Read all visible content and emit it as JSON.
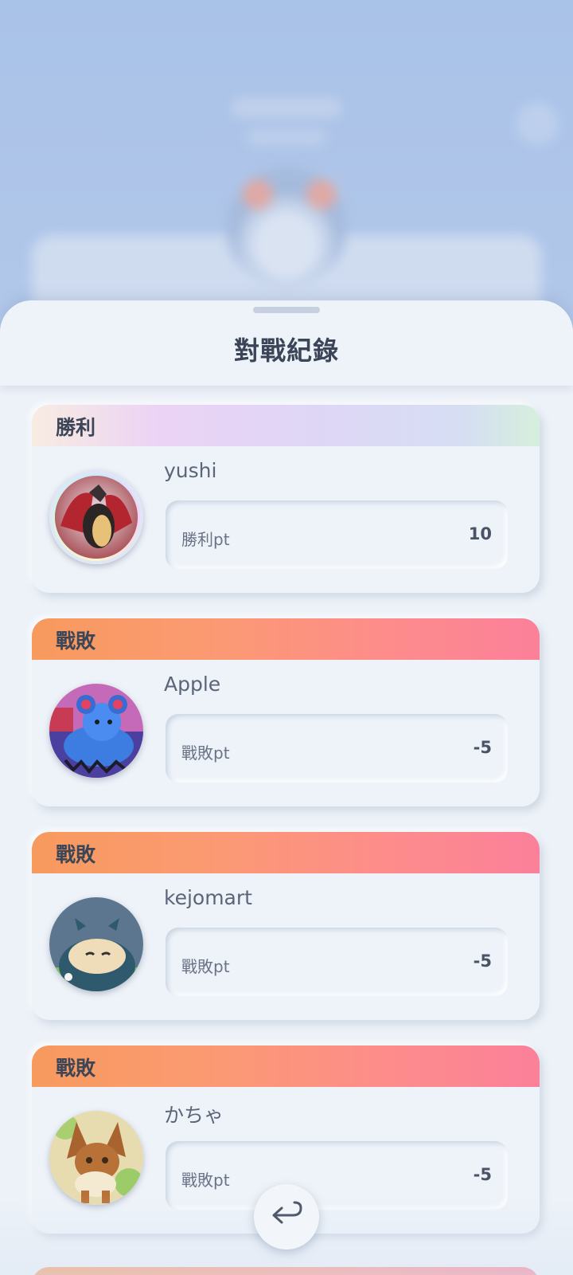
{
  "sheet": {
    "title": "對戰紀錄"
  },
  "records": [
    {
      "result": "勝利",
      "result_type": "win",
      "player": "yushi",
      "pt_label": "勝利pt",
      "pt_value": "10",
      "avatar_icon": "charizard-avatar-icon"
    },
    {
      "result": "戰敗",
      "result_type": "lose",
      "player": "Apple",
      "pt_label": "戰敗pt",
      "pt_value": "-5",
      "avatar_icon": "marill-avatar-icon"
    },
    {
      "result": "戰敗",
      "result_type": "lose",
      "player": "kejomart",
      "pt_label": "戰敗pt",
      "pt_value": "-5",
      "avatar_icon": "snorlax-avatar-icon"
    },
    {
      "result": "戰敗",
      "result_type": "lose",
      "player": "かちゃ",
      "pt_label": "戰敗pt",
      "pt_value": "-5",
      "avatar_icon": "eevee-avatar-icon"
    }
  ],
  "colors": {
    "win_banner": "#ebd3f5",
    "lose_banner_start": "#f79a5e",
    "lose_banner_end": "#fb809a",
    "sheet_bg": "#edf2f8"
  },
  "back_button": {
    "icon": "return-arrow-icon"
  }
}
